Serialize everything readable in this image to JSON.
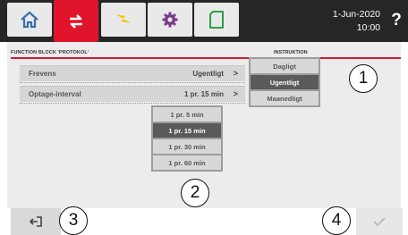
{
  "header": {
    "tabs": [
      {
        "icon": "home-icon",
        "active": false
      },
      {
        "icon": "transfer-arrows-icon",
        "active": true
      },
      {
        "icon": "bolt-icon",
        "active": false
      },
      {
        "icon": "gear-icon",
        "active": false
      },
      {
        "icon": "sd-card-icon",
        "active": false
      }
    ],
    "date": "1-Jun-2020",
    "time": "10:00",
    "help": "?"
  },
  "section_title": "FUNCTION BLOCK 'PROTOKOL'",
  "instruktion_title": "INSTRUKTION",
  "settings": [
    {
      "label": "Frevens",
      "value": "Ugentligt",
      "chevron": ">"
    },
    {
      "label": "Optage-interval",
      "value": "1 pr. 15 min",
      "chevron": ">"
    }
  ],
  "frequency_options": [
    "Dagligt",
    "Ugentligt",
    "Maanedligt"
  ],
  "frequency_selected": "Ugentligt",
  "interval_options": [
    "1 pr. 5 min",
    "1 pr. 15 min",
    "1 pr. 30 min",
    "1 pr. 60 min"
  ],
  "interval_selected": "1 pr. 15 min",
  "callouts": [
    "1",
    "2",
    "3",
    "4"
  ],
  "footer": {
    "back_icon": "exit-icon",
    "ok_icon": "checkmark-icon"
  },
  "colors": {
    "accent": "#e0142d",
    "topbar": "#262626",
    "selected": "#5a5a5a"
  }
}
